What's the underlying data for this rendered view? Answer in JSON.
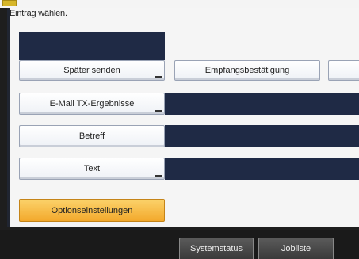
{
  "instruction": "Eintrag wählen.",
  "buttons": {
    "spaeter_senden": "Später senden",
    "empfangsbestaetigung": "Empfangsbestätigung",
    "email_tx": "E-Mail TX-Ergebnisse",
    "betreff": "Betreff",
    "text": "Text",
    "optionseinstellungen": "Optionseinstellungen"
  },
  "statusbar": {
    "systemstatus": "Systemstatus",
    "jobliste": "Jobliste"
  },
  "colors": {
    "dark_field": "#1f2a45",
    "option_button": "#f3a92c",
    "background": "#f5f5f5"
  }
}
